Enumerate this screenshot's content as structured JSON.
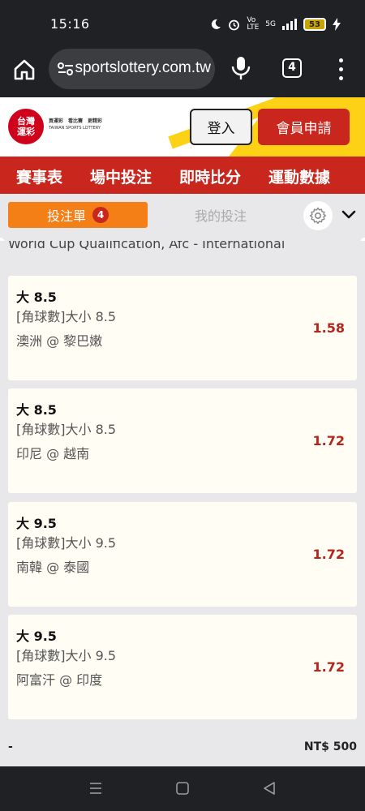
{
  "status_bar": {
    "time": "15:16",
    "network": "5G",
    "battery": "53"
  },
  "browser": {
    "url": "sportslottery.com.tw",
    "tab_count": "4"
  },
  "site_header": {
    "logo_text": "台灣\n運彩",
    "slogan": "買運彩　看比賽　更精彩",
    "slogan_en": "TAIWAN SPORTS LOTTERY",
    "login_label": "登入",
    "register_label": "會員申請"
  },
  "nav": {
    "items": [
      "賽事表",
      "場中投注",
      "即時比分",
      "運動數據"
    ]
  },
  "slip": {
    "tab_slip_label": "投注單",
    "slip_count": "4",
    "tab_mybets_label": "我的投注"
  },
  "league": "World Cup Qualification, Afc - International",
  "bets": [
    {
      "selection": "大 8.5",
      "market": "[角球數]大小 8.5",
      "match": "澳洲 @ 黎巴嫩",
      "odds": "1.58"
    },
    {
      "selection": "大 8.5",
      "market": "[角球數]大小 8.5",
      "match": "印尼 @ 越南",
      "odds": "1.72"
    },
    {
      "selection": "大 9.5",
      "market": "[角球數]大小 9.5",
      "match": "南韓 @ 泰國",
      "odds": "1.72"
    },
    {
      "selection": "大 9.5",
      "market": "[角球數]大小 9.5",
      "match": "阿富汗 @ 印度",
      "odds": "1.72"
    }
  ],
  "summary": {
    "label": "-",
    "amount": "NT$ 500"
  },
  "colors": {
    "brand_red": "#c9261e",
    "slip_orange": "#f57f17",
    "odds_red": "#b3261e",
    "accent_yellow": "#fcd116"
  },
  "icons": {
    "home": "home-icon",
    "site_info": "tune-icon",
    "mic": "mic-icon",
    "menu": "more-vert-icon",
    "settings": "gear-icon",
    "collapse": "chevron-down-icon"
  }
}
